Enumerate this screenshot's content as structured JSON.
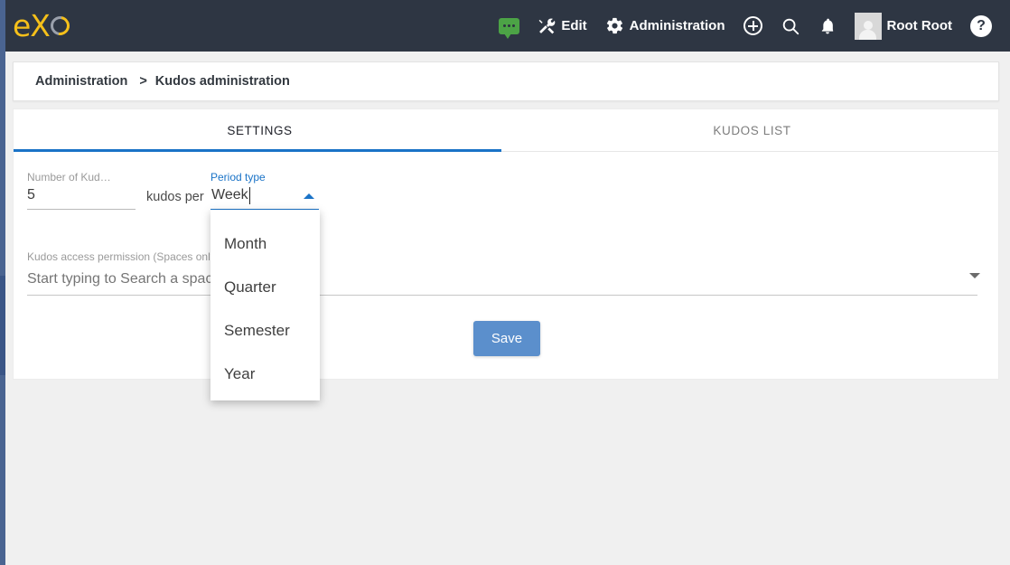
{
  "topbar": {
    "brand": "eXo",
    "nav": [
      {
        "icon": "chat-icon",
        "label": ""
      },
      {
        "icon": "edit-tools-icon",
        "label": "Edit"
      },
      {
        "icon": "gear-icon",
        "label": "Administration"
      },
      {
        "icon": "plus-circle-icon",
        "label": ""
      },
      {
        "icon": "search-icon",
        "label": ""
      },
      {
        "icon": "bell-icon",
        "label": ""
      },
      {
        "icon": "avatar-icon",
        "label": "Root Root"
      },
      {
        "icon": "help-icon",
        "label": ""
      }
    ],
    "user_name": "Root Root",
    "help_glyph": "?",
    "bg_color": "#2e3643",
    "brand_color": "#f5c01a"
  },
  "breadcrumb": {
    "root": "Administration",
    "separator": ">",
    "current": "Kudos administration"
  },
  "tabs": [
    {
      "label": "SETTINGS",
      "active": true
    },
    {
      "label": "KUDOS LIST",
      "active": false
    }
  ],
  "form": {
    "number_of_kudos": {
      "label": "Number of Kud…",
      "value": "5"
    },
    "middle_text": "kudos per",
    "period_type": {
      "label": "Period type",
      "value": "Week",
      "focused": true,
      "caret_icon": "chevron-up-icon",
      "options": [
        "Month",
        "Quarter",
        "Semester",
        "Year"
      ]
    },
    "access_permission": {
      "label": "Kudos access permission (Spaces only)",
      "placeholder": "Start typing to Search a space",
      "value": "",
      "caret_icon": "chevron-down-icon"
    },
    "save_label": "Save"
  },
  "colors": {
    "accent_blue": "#1a73c7",
    "save_blue": "#5b8fcc",
    "rail_blue": "#4a6491",
    "chat_green": "#4ca346"
  }
}
